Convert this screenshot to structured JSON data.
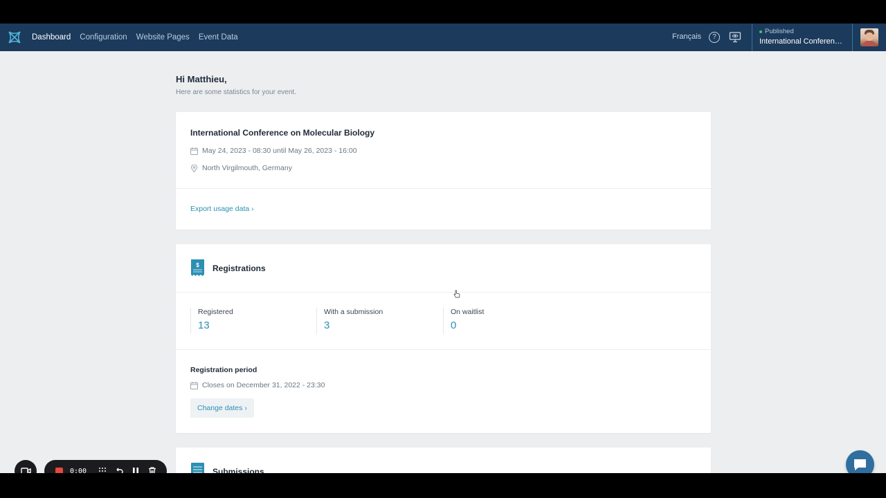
{
  "nav": {
    "items": [
      {
        "label": "Dashboard",
        "active": true
      },
      {
        "label": "Configuration",
        "active": false
      },
      {
        "label": "Website Pages",
        "active": false
      },
      {
        "label": "Event Data",
        "active": false
      }
    ],
    "language": "Français",
    "status": "Published",
    "event_name": "International Conference on Molecular Biology",
    "event_name_display": "International Conference..."
  },
  "greeting": {
    "title": "Hi Matthieu,",
    "subtitle": "Here are some statistics for your event."
  },
  "event_card": {
    "title": "International Conference on Molecular Biology",
    "dates": "May 24, 2023 - 08:30 until May 26, 2023 - 16:00",
    "location": "North Virgilmouth, Germany",
    "export_link": "Export usage data"
  },
  "registrations": {
    "title": "Registrations",
    "stats": [
      {
        "label": "Registered",
        "value": "13"
      },
      {
        "label": "With a submission",
        "value": "3"
      },
      {
        "label": "On waitlist",
        "value": "0"
      }
    ],
    "period_title": "Registration period",
    "closes": "Closes on December 31, 2022 - 23:30",
    "change_button": "Change dates"
  },
  "submissions": {
    "title": "Submissions"
  },
  "recorder": {
    "time": "0:00"
  },
  "colors": {
    "nav_bg": "#1b3a5c",
    "accent": "#2d8fb3",
    "page_bg": "#eceef0",
    "record_red": "#e5483f",
    "status_green": "#3cc27a"
  }
}
